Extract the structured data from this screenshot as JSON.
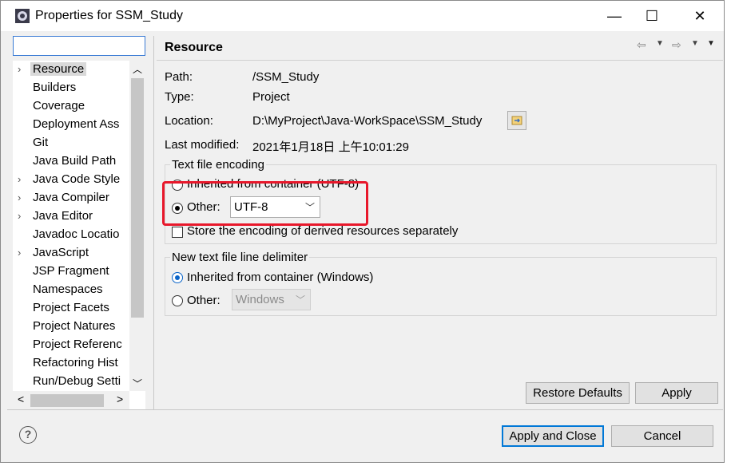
{
  "window": {
    "title": "Properties for SSM_Study",
    "minimize": "—",
    "maximize": "☐",
    "close": "✕"
  },
  "filter": {
    "value": "",
    "placeholder": ""
  },
  "tree": {
    "items": [
      {
        "label": "Resource",
        "expandable": true,
        "selected": true
      },
      {
        "label": "Builders",
        "expandable": false
      },
      {
        "label": "Coverage",
        "expandable": false
      },
      {
        "label": "Deployment Ass",
        "expandable": false
      },
      {
        "label": "Git",
        "expandable": false
      },
      {
        "label": "Java Build Path",
        "expandable": false
      },
      {
        "label": "Java Code Style",
        "expandable": true
      },
      {
        "label": "Java Compiler",
        "expandable": true
      },
      {
        "label": "Java Editor",
        "expandable": true
      },
      {
        "label": "Javadoc Locatio",
        "expandable": false
      },
      {
        "label": "JavaScript",
        "expandable": true
      },
      {
        "label": "JSP Fragment",
        "expandable": false
      },
      {
        "label": "Namespaces",
        "expandable": false
      },
      {
        "label": "Project Facets",
        "expandable": false
      },
      {
        "label": "Project Natures",
        "expandable": false
      },
      {
        "label": "Project Referenc",
        "expandable": false
      },
      {
        "label": "Refactoring Hist",
        "expandable": false
      },
      {
        "label": "Run/Debug Setti",
        "expandable": false
      }
    ]
  },
  "page": {
    "title": "Resource",
    "path_label": "Path:",
    "path_value": "/SSM_Study",
    "type_label": "Type:",
    "type_value": "Project",
    "location_label": "Location:",
    "location_value": "D:\\MyProject\\Java-WorkSpace\\SSM_Study",
    "modified_label": "Last modified:",
    "modified_value": "2021年1月18日 上午10:01:29"
  },
  "encoding": {
    "group_title": "Text file encoding",
    "inherited_label": "Inherited from container (UTF-8)",
    "other_label": "Other:",
    "other_value": "UTF-8",
    "selected": "other",
    "store_label": "Store the encoding of derived resources separately"
  },
  "delimiter": {
    "group_title": "New text file line delimiter",
    "inherited_label": "Inherited from container (Windows)",
    "other_label": "Other:",
    "other_value": "Windows",
    "selected": "inherited"
  },
  "buttons": {
    "restore_defaults": "Restore Defaults",
    "apply": "Apply",
    "apply_and_close": "Apply and Close",
    "cancel": "Cancel",
    "help": "?"
  },
  "colors": {
    "highlight": "#e8182b",
    "accent": "#0078d7"
  }
}
